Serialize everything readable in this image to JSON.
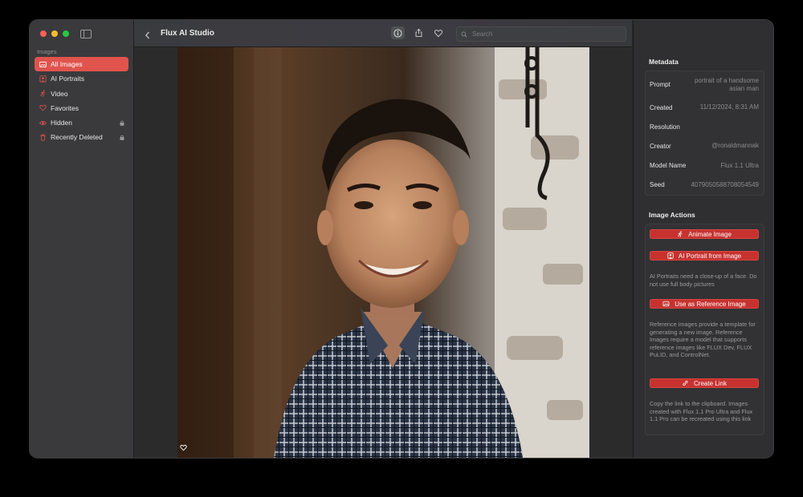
{
  "window": {
    "title": "Flux AI Studio"
  },
  "sidebar": {
    "section_label": "Images",
    "items": [
      {
        "label": "All Images",
        "icon": "photos-icon",
        "active": true,
        "locked": false
      },
      {
        "label": "AI Portraits",
        "icon": "portrait-icon",
        "active": false,
        "locked": false
      },
      {
        "label": "Video",
        "icon": "running-figure-icon",
        "active": false,
        "locked": false
      },
      {
        "label": "Favorites",
        "icon": "heart-icon",
        "active": false,
        "locked": false
      },
      {
        "label": "Hidden",
        "icon": "eye-icon",
        "active": false,
        "locked": true
      },
      {
        "label": "Recently Deleted",
        "icon": "trash-icon",
        "active": false,
        "locked": true
      }
    ]
  },
  "toolbar": {
    "search_placeholder": "Search",
    "buttons": [
      "back-icon",
      "info-icon",
      "share-icon",
      "heart-icon"
    ]
  },
  "metadata": {
    "heading": "Metadata",
    "rows": [
      {
        "key": "Prompt",
        "value": "portrait of a handsome asian man"
      },
      {
        "key": "Created",
        "value": "11/12/2024, 8:31 AM"
      },
      {
        "key": "Resolution",
        "value": ""
      },
      {
        "key": "Creator",
        "value": "@ronaldmannak"
      },
      {
        "key": "Model Name",
        "value": "Flux 1.1 Ultra"
      },
      {
        "key": "Seed",
        "value": "4079050588708054549"
      }
    ]
  },
  "actions": {
    "heading": "Image Actions",
    "animate": "Animate Image",
    "portrait": "AI Portrait from Image",
    "portrait_note": "AI Portraits need a close-up of a face. Do not use full body pictures",
    "reference": "Use as Reference Image",
    "reference_note": "Reference images provide a template for generating a new image. Reference Images require a model that supports reference images like FLUX Dev, FLUX PuLID, and ControlNet.",
    "link": "Create Link",
    "link_note": "Copy the link to the clipboard. Images created with Flux 1.1 Pro Ultra and Flux 1.1 Pro can be recreated using this link"
  },
  "colors": {
    "accent": "#e0544d",
    "button": "#c7322f",
    "close": "#ff5f57",
    "minimize": "#febc2e",
    "zoom": "#28c840"
  }
}
